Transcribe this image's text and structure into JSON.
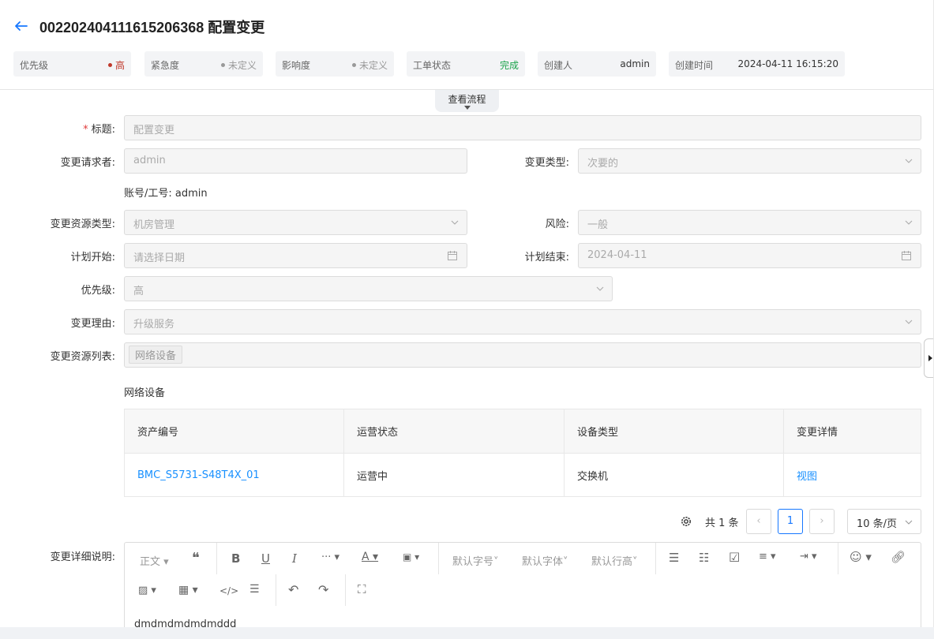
{
  "header": {
    "title": "00220240411161520636​8 配置变更",
    "chips": [
      {
        "label": "优先级",
        "value": "高",
        "dot_color": "#c0392b",
        "value_color": "#c0392b"
      },
      {
        "label": "紧急度",
        "value": "未定义",
        "dot_color": "#999999",
        "value_color": "#999999"
      },
      {
        "label": "影响度",
        "value": "未定义",
        "dot_color": "#999999",
        "value_color": "#999999"
      },
      {
        "label": "工单状态",
        "value": "完成",
        "value_color": "#1aa34a"
      },
      {
        "label": "创建人",
        "value": "admin"
      },
      {
        "label": "创建时间",
        "value": "2024-04-11 16:15:20"
      }
    ]
  },
  "flow_tab": "查看流程",
  "form": {
    "title_label": "标题:",
    "title_value": "配置变更",
    "requester_label": "变更请求者:",
    "requester_value": "admin",
    "change_type_label": "变更类型:",
    "change_type_value": "次要的",
    "account_text": "账号/工号: admin",
    "resource_type_label": "变更资源类型:",
    "resource_type_value": "机房管理",
    "risk_label": "风险:",
    "risk_value": "一般",
    "plan_start_label": "计划开始:",
    "plan_start_placeholder": "请选择日期",
    "plan_end_label": "计划结束:",
    "plan_end_value": "2024-04-11",
    "priority_label": "优先级:",
    "priority_value": "高",
    "reason_label": "变更理由:",
    "reason_value": "升级服务",
    "resource_list_label": "变更资源列表:",
    "resource_list_tag": "网络设备",
    "section_title": "网络设备",
    "detail_label": "变更详细说明:"
  },
  "table": {
    "columns": [
      "资产编号",
      "运营状态",
      "设备类型",
      "变更详情"
    ],
    "rows": [
      [
        "BMC_S5731-S48T4X_01",
        "运营中",
        "交换机",
        "视图"
      ]
    ]
  },
  "pagination": {
    "total_text": "共 1 条",
    "current_page": "1",
    "page_size": "10 条/页"
  },
  "editor": {
    "paragraph": "正文",
    "font_size": "默认字号",
    "font_family": "默认字体",
    "line_height": "默认行高",
    "content": "dmdmdmdmdmddd"
  },
  "colors": {
    "accent": "#1677ff",
    "link": "#1890ff",
    "required": "#e03b3b"
  }
}
